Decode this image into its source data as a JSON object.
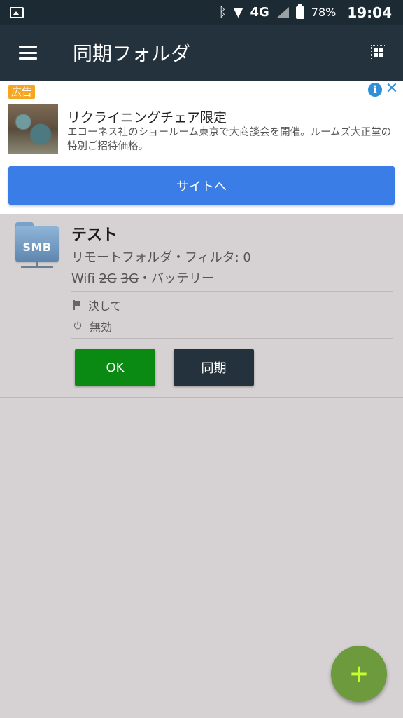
{
  "status_bar": {
    "network": "4G",
    "battery": "78%",
    "time": "19:04"
  },
  "app_bar": {
    "title": "同期フォルダ"
  },
  "ad": {
    "label": "広告",
    "info": "i",
    "close": "✕",
    "title": "リクライニングチェア限定",
    "description": "エコーネス社のショールーム東京で大商談会を開催。ルームズ大正堂の特別ご招待価格。",
    "cta": "サイトへ"
  },
  "folder": {
    "icon_text": "SMB",
    "name": "テスト",
    "subtitle": "リモートフォルダ・フィルタ: 0",
    "conditions": {
      "wifi": "Wifi",
      "g2": "2G",
      "g3": "3G",
      "battery": "・バッテリー"
    },
    "mode": "決して",
    "power": "無効",
    "ok_label": "OK",
    "sync_label": "同期"
  },
  "fab": {
    "label": "+"
  },
  "colors": {
    "app_bar": "#24323e",
    "status_bar": "#1c2a34",
    "ok_button": "#0a8a12",
    "cta": "#3b7de6",
    "fab": "#6c9a3c"
  }
}
